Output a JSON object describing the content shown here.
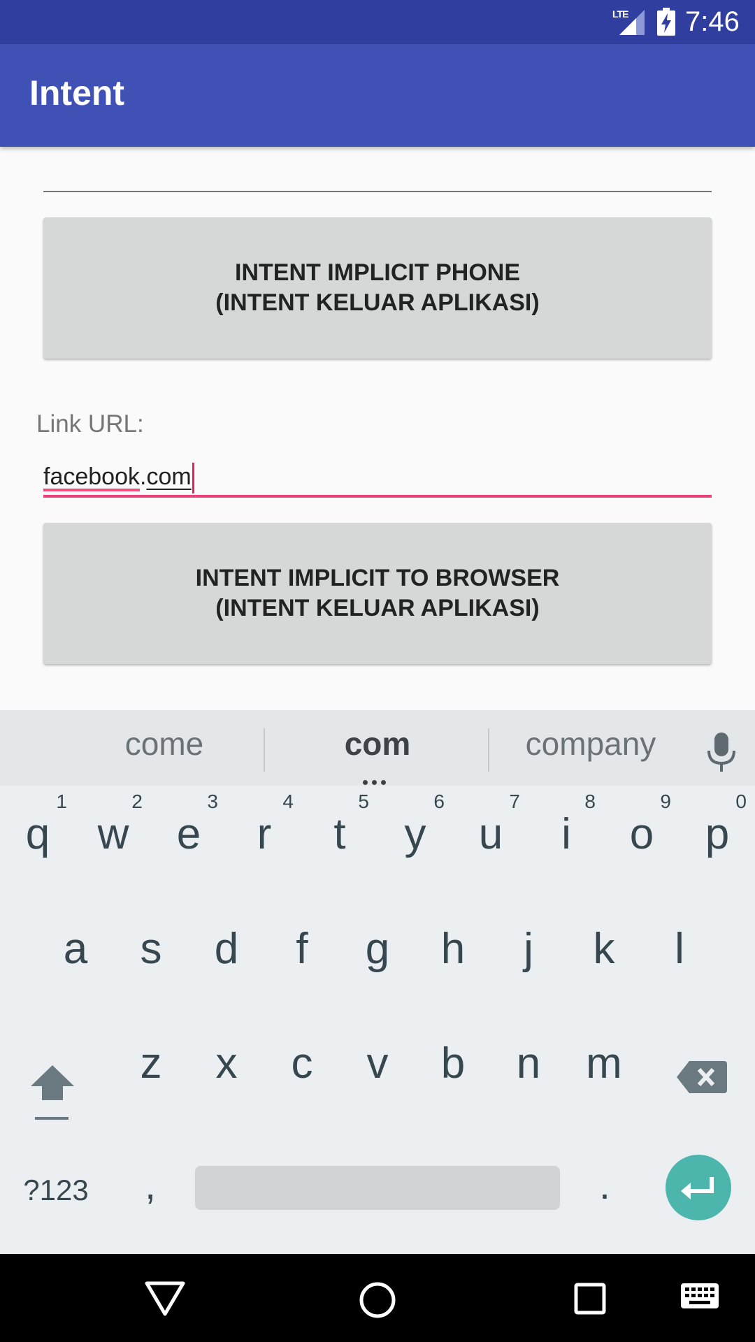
{
  "status_bar": {
    "network_label": "LTE",
    "time": "7:46"
  },
  "toolbar": {
    "title": "Intent"
  },
  "buttons": {
    "phone": {
      "line1": "INTENT IMPLICIT PHONE",
      "line2": "(INTENT KELUAR APLIKASI)"
    },
    "browser": {
      "line1": "INTENT IMPLICIT TO BROWSER",
      "line2": "(INTENT KELUAR APLIKASI)"
    }
  },
  "url_field": {
    "label": "Link URL:",
    "value_part1": "facebook",
    "value_part2": ".",
    "value_part3": "com"
  },
  "keyboard": {
    "suggestions": [
      "come",
      "com",
      "company"
    ],
    "row1": [
      {
        "char": "q",
        "num": "1"
      },
      {
        "char": "w",
        "num": "2"
      },
      {
        "char": "e",
        "num": "3"
      },
      {
        "char": "r",
        "num": "4"
      },
      {
        "char": "t",
        "num": "5"
      },
      {
        "char": "y",
        "num": "6"
      },
      {
        "char": "u",
        "num": "7"
      },
      {
        "char": "i",
        "num": "8"
      },
      {
        "char": "o",
        "num": "9"
      },
      {
        "char": "p",
        "num": "0"
      }
    ],
    "row2": [
      "a",
      "s",
      "d",
      "f",
      "g",
      "h",
      "j",
      "k",
      "l"
    ],
    "row3": [
      "z",
      "x",
      "c",
      "v",
      "b",
      "n",
      "m"
    ],
    "symbols_label": "?123",
    "comma": ",",
    "period": "."
  },
  "colors": {
    "status_bar": "#303f9f",
    "toolbar": "#3f51b5",
    "accent": "#ec407a",
    "enter_key": "#4db6ac"
  }
}
